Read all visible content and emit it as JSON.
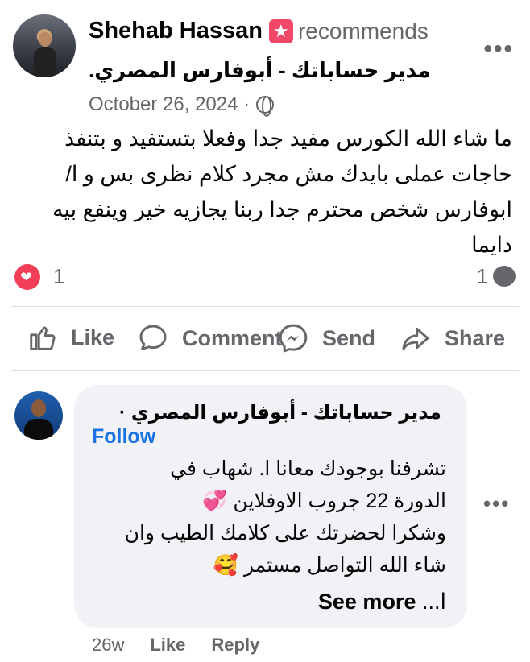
{
  "post": {
    "author": "Shehab Hassan",
    "recommend_icon": "recommend-star-icon",
    "recommends_label": "recommends",
    "page_name": "مدير حساباتك - أبوفارس المصري.",
    "date": "October 26, 2024 ·",
    "privacy_icon": "globe-icon",
    "more_label": "•••",
    "text": "ما شاء الله الكورس مفيد جدا وفعلا بتستفيد و بتنفذ حاجات عملى بايدك مش مجرد كلام نظرى بس و ا/ ابوفارس شخص محترم جدا ربنا يجازيه خير وينفع بيه دايما",
    "reactions_count": "1",
    "comments_count": "1"
  },
  "actions": {
    "like_label": "Like",
    "comment_label": "Comment",
    "send_label": "Send",
    "share_label": "Share"
  },
  "comment": {
    "author": "مدير حساباتك - أبوفارس المصري ·",
    "follow_label": "Follow",
    "line1": "تشرفنا بوجودك معانا ا. شهاب في",
    "line2": "الدورة 22 جروب الاوفلاين 💞",
    "line3": "وشكرا لحضرتك على كلامك الطيب وان",
    "line4": "شاء الله التواصل مستمر 🥰",
    "see_more_prefix": "ا...",
    "see_more_label": "See more",
    "more_label": "•••",
    "time": "26w",
    "like_label": "Like",
    "reply_label": "Reply"
  },
  "colors": {
    "accent": "#1b74e4",
    "love": "#f33e58",
    "recommend": "#f2476a",
    "secondary_text": "#65676b",
    "bubble": "#f0f2f5"
  }
}
